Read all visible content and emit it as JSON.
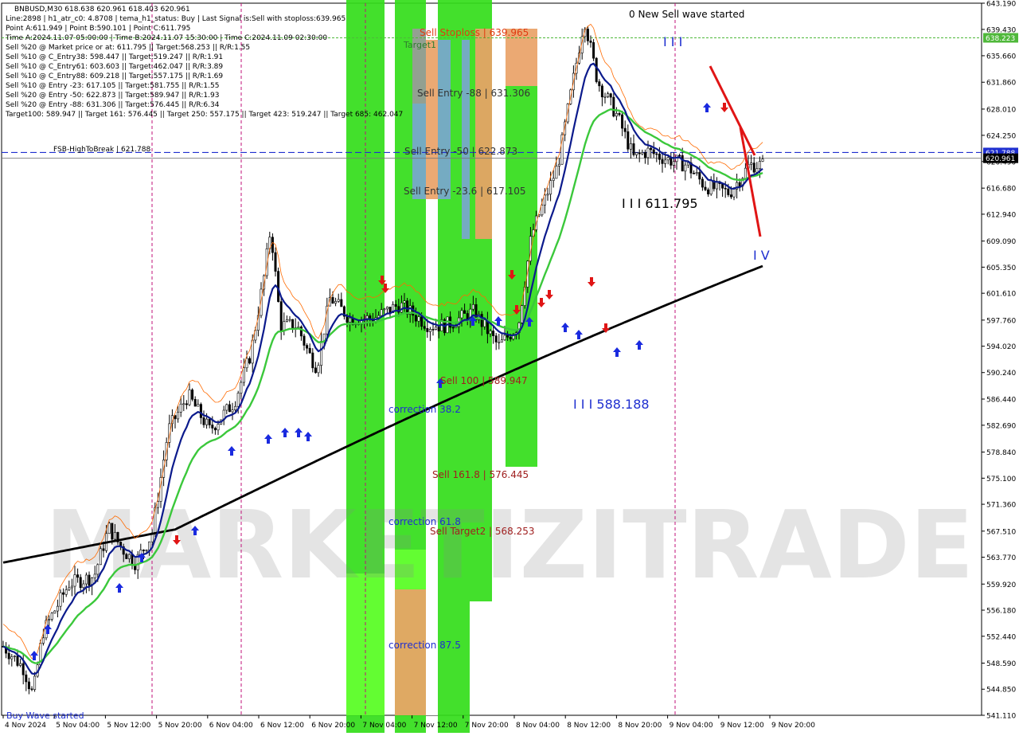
{
  "chart_data": {
    "type": "candlestick",
    "symbol_line": "BNBUSD,M30  618.638 620.961 618.403 620.961",
    "info_lines": [
      "Line:2898 | h1_atr_c0: 4.8708 | tema_h1_status: Buy | Last Signal is:Sell with stoploss:639.965",
      "Point A:611.949 | Point B:590.101 | Point C:611.795",
      "Time A:2024.11.07 05:00:00 | Time B:2024.11.07 15:30:00 | Time C:2024.11.09 02:30:00",
      "Sell %20 @ Market price or at: 611.795 || Target:568.253 || R/R:1.55",
      "Sell %10 @ C_Entry38: 598.447 || Target:519.247 || R/R:1.91",
      "Sell %10 @ C_Entry61: 603.603 || Target:462.047 || R/R:3.89",
      "Sell %10 @ C_Entry88: 609.218 || Target:557.175 || R/R:1.69",
      "Sell %10 @ Entry -23: 617.105 || Target:581.755 || R/R:1.55",
      "Sell %20 @ Entry -50: 622.873 || Target:589.947 || R/R:1.93",
      "Sell %20 @ Entry -88: 631.306 || Target:576.445 || R/R:6.34",
      "Target100: 589.947 || Target 161: 576.445 || Target 250: 557.175 || Target 423: 519.247 || Target 685: 462.047"
    ],
    "y_ticks": [
      "643.190",
      "639.430",
      "635.660",
      "631.860",
      "628.010",
      "624.250",
      "620.490",
      "616.680",
      "612.940",
      "609.090",
      "605.350",
      "601.610",
      "597.760",
      "594.020",
      "590.240",
      "586.440",
      "582.690",
      "578.840",
      "575.100",
      "571.360",
      "567.510",
      "563.770",
      "559.920",
      "556.180",
      "552.440",
      "548.590",
      "544.850",
      "541.110"
    ],
    "ylim": [
      541.11,
      643.19
    ],
    "x_ticks": [
      "4 Nov 2024",
      "5 Nov 04:00",
      "5 Nov 12:00",
      "5 Nov 20:00",
      "6 Nov 04:00",
      "6 Nov 12:00",
      "6 Nov 20:00",
      "7 Nov 04:00",
      "7 Nov 12:00",
      "7 Nov 20:00",
      "8 Nov 04:00",
      "8 Nov 12:00",
      "8 Nov 20:00",
      "9 Nov 04:00",
      "9 Nov 12:00",
      "9 Nov 20:00"
    ],
    "price_labels": [
      {
        "value": 638.223,
        "text": "638.223",
        "color": "#4fb83a"
      },
      {
        "value": 621.788,
        "text": "621.788",
        "color": "#1f2fd0"
      },
      {
        "value": 620.961,
        "text": "620.961",
        "color": "#000000"
      }
    ],
    "levels": [
      {
        "label": "Target1",
        "value": 638.223
      },
      {
        "label": "FSB-HighToBreak | 621.788",
        "value": 621.788
      }
    ],
    "zone_labels": [
      {
        "text": "Sell Stoploss | 639.965",
        "value": 639.965,
        "color": "#e03a10"
      },
      {
        "text": "Sell Entry -88 | 631.306",
        "value": 631.306,
        "color": "#333333"
      },
      {
        "text": "Sell Entry -50 | 622.873",
        "value": 622.873,
        "color": "#333333"
      },
      {
        "text": "Sell Entry -23.6 | 617.105",
        "value": 617.105,
        "color": "#333333"
      },
      {
        "text": "Sell 100 | 589.947",
        "value": 589.947,
        "color": "#a02020"
      },
      {
        "text": "Sell 161.8 | 576.445",
        "value": 576.445,
        "color": "#a02020"
      },
      {
        "text": "Sell Target2 | 568.253",
        "value": 568.253,
        "color": "#a02020"
      },
      {
        "text": "correction 38.2",
        "value": 587.1,
        "color": "#1f2fd0"
      },
      {
        "text": "correction 61.8",
        "value": 569.6,
        "color": "#1f2fd0"
      },
      {
        "text": "correction 87.5",
        "value": 551.8,
        "color": "#1f2fd0"
      }
    ],
    "wave_labels": [
      {
        "text": "0 New Sell wave started",
        "color": "#000000"
      },
      {
        "text": "I I I",
        "color": "#1f2fd0"
      },
      {
        "text": "I I I 611.795",
        "color": "#000000"
      },
      {
        "text": "I V",
        "color": "#1f2fd0"
      },
      {
        "text": "I I I 588.188",
        "color": "#1f2fd0"
      },
      {
        "text": "Buy Wave started",
        "color": "#1f2fd0"
      }
    ],
    "watermark": "MARKETIZITRADE",
    "colors": {
      "green_zone": "#33dd1a",
      "light_green": "#66ff33",
      "orange": "#e9a267",
      "steel_blue": "#7aa6cf",
      "gray": "#9a9a9a",
      "ema_black": "#000000",
      "ema_navy": "#0b1a8c",
      "ema_green": "#3bc83b",
      "arrow_blue": "#1a2adf",
      "arrow_red": "#e01515",
      "level_blue": "#1f2fd0",
      "level_green": "#4fb83a",
      "vline_magenta": "#c0107a"
    }
  }
}
